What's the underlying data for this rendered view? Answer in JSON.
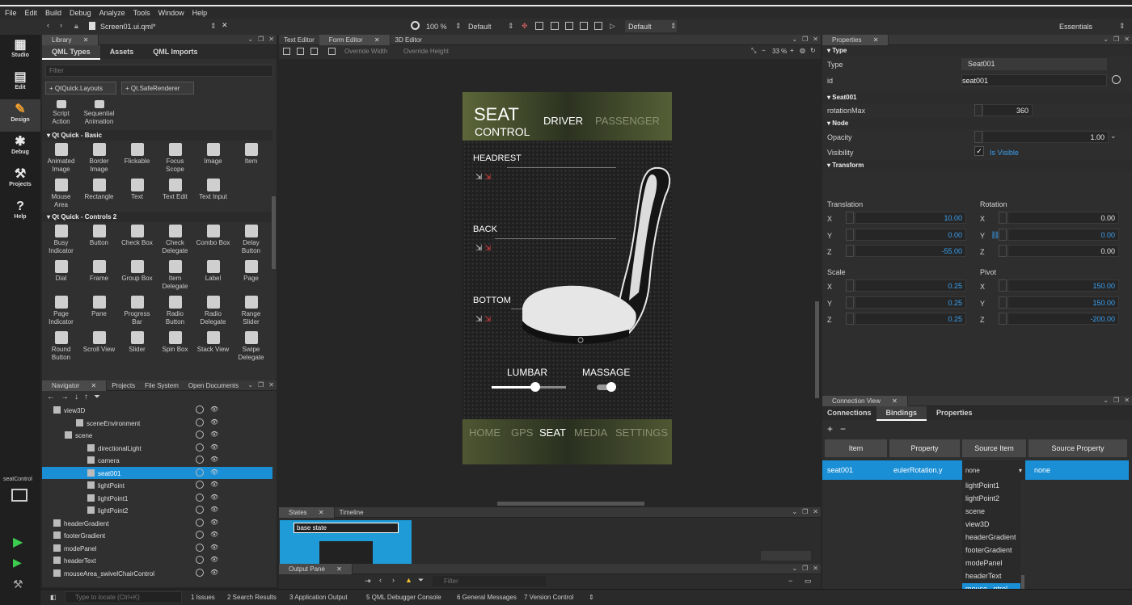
{
  "menu": [
    "File",
    "Edit",
    "Build",
    "Debug",
    "Analyze",
    "Tools",
    "Window",
    "Help"
  ],
  "toolbar": {
    "file": "Screen01.ui.qml*",
    "zoom": "100 %",
    "style": "Default",
    "theme": "Default",
    "workspace": "Essentials"
  },
  "modes": [
    {
      "label": "Studio",
      "icon": "grid-icon"
    },
    {
      "label": "Edit",
      "icon": "document-icon"
    },
    {
      "label": "Design",
      "icon": "pencil-icon"
    },
    {
      "label": "Debug",
      "icon": "bug-icon"
    },
    {
      "label": "Projects",
      "icon": "wrench-icon"
    },
    {
      "label": "Help",
      "icon": "question-icon"
    }
  ],
  "sidebar_bottom": {
    "project": "seatControl"
  },
  "library": {
    "tab": "Library",
    "subtabs": [
      "QML Types",
      "Assets",
      "QML Imports"
    ],
    "filter_placeholder": "Filter",
    "imports": [
      "+ QtQuick.Layouts",
      "+ Qt.SafeRenderer"
    ],
    "top_items": [
      "Script\nAction",
      "Sequential\nAnimation"
    ],
    "cat1": "Qt Quick - Basic",
    "basic": [
      "Animated\nImage",
      "Border\nImage",
      "Flickable",
      "Focus\nScope",
      "Image",
      "Item",
      "Mouse\nArea",
      "Rectangle",
      "Text",
      "Text Edit",
      "Text Input"
    ],
    "cat2": "Qt Quick - Controls 2",
    "controls": [
      "Busy\nIndicator",
      "Button",
      "Check Box",
      "Check\nDelegate",
      "Combo Box",
      "Delay\nButton",
      "Dial",
      "Frame",
      "Group Box",
      "Item\nDelegate",
      "Label",
      "Page",
      "Page\nIndicator",
      "Pane",
      "Progress\nBar",
      "Radio\nButton",
      "Radio\nDelegate",
      "Range\nSlider",
      "Round\nButton",
      "Scroll View",
      "Slider",
      "Spin Box",
      "Stack View",
      "Swipe\nDelegate"
    ]
  },
  "navigator": {
    "tabs": [
      "Navigator",
      "Projects",
      "File System",
      "Open Documents"
    ],
    "rows": [
      {
        "label": "view3D",
        "indent": 0
      },
      {
        "label": "sceneEnvironment",
        "indent": 2
      },
      {
        "label": "scene",
        "indent": 1
      },
      {
        "label": "directionalLight",
        "indent": 3
      },
      {
        "label": "camera",
        "indent": 3
      },
      {
        "label": "seat001",
        "indent": 3,
        "selected": true
      },
      {
        "label": "lightPoint",
        "indent": 3
      },
      {
        "label": "lightPoint1",
        "indent": 3
      },
      {
        "label": "lightPoint2",
        "indent": 3
      },
      {
        "label": "headerGradient",
        "indent": 0
      },
      {
        "label": "footerGradient",
        "indent": 0
      },
      {
        "label": "modePanel",
        "indent": 0
      },
      {
        "label": "headerText",
        "indent": 0
      },
      {
        "label": "mouseArea_swivelChairControl",
        "indent": 0
      }
    ]
  },
  "editor": {
    "tabs": [
      "Text Editor",
      "Form Editor",
      "3D Editor"
    ],
    "override_width": "Override Width",
    "override_height": "Override Height",
    "zoom": "33 %"
  },
  "app": {
    "title1": "SEAT",
    "title2": "CONTROL",
    "driver": "DRIVER",
    "passenger": "PASSENGER",
    "headrest": "HEADREST",
    "back": "BACK",
    "bottom": "BOTTOM",
    "lumbar": "LUMBAR",
    "massage": "MASSAGE",
    "nav": [
      "HOME",
      "GPS",
      "SEAT",
      "MEDIA",
      "SETTINGS"
    ]
  },
  "states": {
    "tabs": [
      "States",
      "Timeline"
    ],
    "base": "base state"
  },
  "output": {
    "tab": "Output Pane",
    "filter_placeholder": "Filter"
  },
  "properties": {
    "tab": "Properties",
    "type_section": "Type",
    "type_label": "Type",
    "type_value": "Seat001",
    "id_label": "id",
    "id_value": "seat001",
    "seat_section": "Seat001",
    "rotmax_label": "rotationMax",
    "rotmax_value": "360",
    "node_section": "Node",
    "opacity_label": "Opacity",
    "opacity_value": "1.00",
    "visibility_label": "Visibility",
    "visible_text": "Is Visible",
    "transform_section": "Transform",
    "translation": "Translation",
    "rotation": "Rotation",
    "scale": "Scale",
    "pivot": "Pivot",
    "tx": "10.00",
    "ty": "0.00",
    "tz": "-55.00",
    "rx": "0.00",
    "ry": "0.00",
    "rz": "0.00",
    "sx": "0.25",
    "sy": "0.25",
    "sz": "0.25",
    "px": "150.00",
    "py": "150.00",
    "pz": "-200.00"
  },
  "connection": {
    "tab": "Connection View",
    "subtabs": [
      "Connections",
      "Bindings",
      "Properties"
    ],
    "cols": [
      "Item",
      "Property",
      "Source Item",
      "Source Property"
    ],
    "row": {
      "item": "seat001",
      "property": "eulerRotation.y",
      "source_item": "none",
      "source_property": "none"
    },
    "dropdown": [
      "lightPoint1",
      "lightPoint2",
      "scene",
      "view3D",
      "headerGradient",
      "footerGradient",
      "modePanel",
      "headerText",
      "mouse...ntrol"
    ]
  },
  "status": {
    "locate_placeholder": "Type to locate (Ctrl+K)",
    "items": [
      "1  Issues",
      "2  Search Results",
      "3  Application Output",
      "5  QML Debugger Console",
      "6  General Messages",
      "7  Version Control"
    ]
  },
  "colors": {
    "selection": "#1a8fd6",
    "accent_value": "#3aa0f0"
  }
}
